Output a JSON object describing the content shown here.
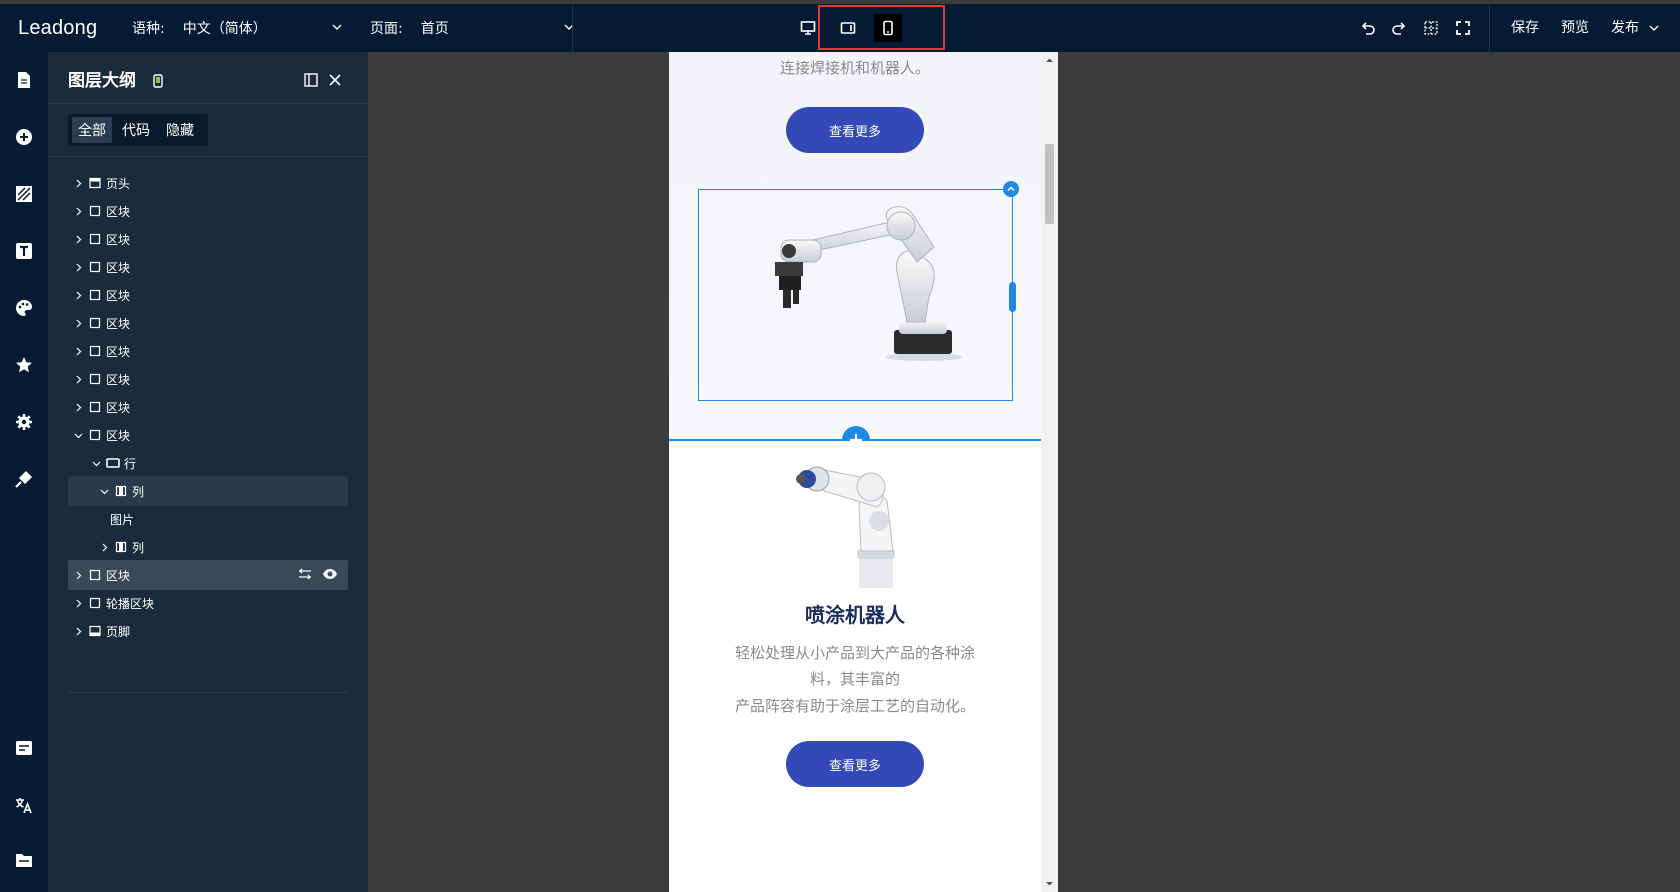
{
  "app": {
    "logo": "Leadong"
  },
  "toolbar": {
    "language_label": "语种:",
    "language_value": "中文（简体）",
    "page_label": "页面:",
    "page_value": "首页",
    "save": "保存",
    "preview": "预览",
    "publish": "发布"
  },
  "panel": {
    "title": "图层大纲",
    "filters": [
      "全部",
      "代码",
      "隐藏"
    ],
    "active_filter": "全部",
    "tree": [
      {
        "label": "页头",
        "icon": "header-icon",
        "depth": 0,
        "state": "collapsed"
      },
      {
        "label": "区块",
        "icon": "block-icon",
        "depth": 0,
        "state": "collapsed"
      },
      {
        "label": "区块",
        "icon": "block-icon",
        "depth": 0,
        "state": "collapsed"
      },
      {
        "label": "区块",
        "icon": "block-icon",
        "depth": 0,
        "state": "collapsed"
      },
      {
        "label": "区块",
        "icon": "block-icon",
        "depth": 0,
        "state": "collapsed"
      },
      {
        "label": "区块",
        "icon": "block-icon",
        "depth": 0,
        "state": "collapsed"
      },
      {
        "label": "区块",
        "icon": "block-icon",
        "depth": 0,
        "state": "collapsed"
      },
      {
        "label": "区块",
        "icon": "block-icon",
        "depth": 0,
        "state": "collapsed"
      },
      {
        "label": "区块",
        "icon": "block-icon",
        "depth": 0,
        "state": "collapsed"
      },
      {
        "label": "区块",
        "icon": "block-icon",
        "depth": 0,
        "state": "expanded"
      },
      {
        "label": "行",
        "icon": "row-icon",
        "depth": 1,
        "state": "expanded"
      },
      {
        "label": "列",
        "icon": "column-icon",
        "depth": 2,
        "state": "expanded",
        "selected": true
      },
      {
        "label": "图片",
        "icon": "",
        "depth": 3,
        "state": "leaf"
      },
      {
        "label": "列",
        "icon": "column-icon",
        "depth": 2,
        "state": "collapsed"
      },
      {
        "label": "区块",
        "icon": "block-icon",
        "depth": 0,
        "state": "collapsed",
        "hover": true
      },
      {
        "label": "轮播区块",
        "icon": "block-icon",
        "depth": 0,
        "state": "collapsed"
      },
      {
        "label": "页脚",
        "icon": "footer-icon",
        "depth": 0,
        "state": "collapsed"
      }
    ]
  },
  "preview": {
    "sec1_text": "连接焊接机和机器人。",
    "sec1_button": "查看更多",
    "sec2_title": "喷涂机器人",
    "sec2_text_1": "轻松处理从小产品到大产品的各种涂",
    "sec2_text_2": "料，其丰富的",
    "sec2_text_3": "产品阵容有助于涂层工艺的自动化。",
    "sec2_button": "查看更多"
  },
  "colors": {
    "topbar": "#051a33",
    "panel": "#1c2b3b",
    "accent": "#1e88e5",
    "button": "#3349b8",
    "highlight_border": "#e53935"
  }
}
